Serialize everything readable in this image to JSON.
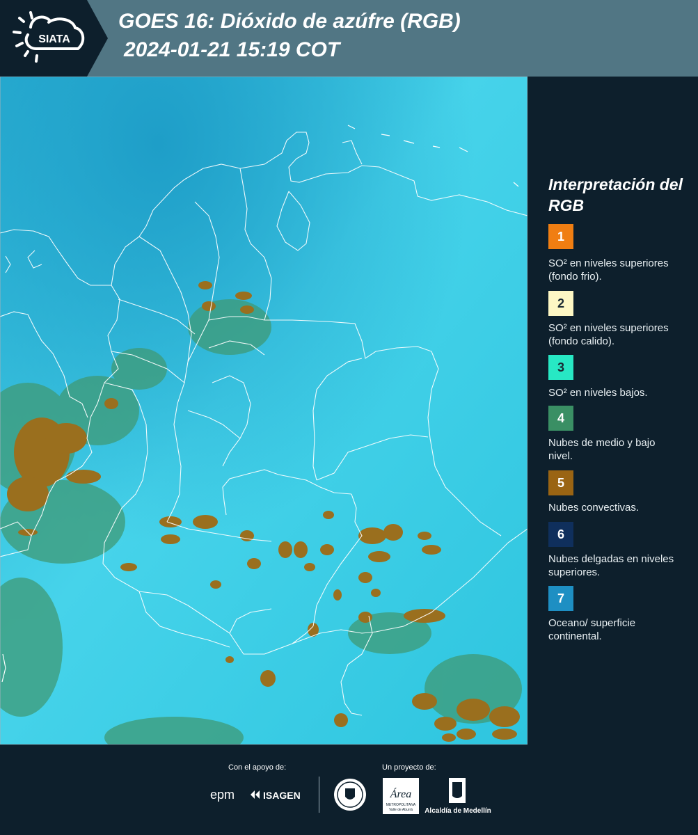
{
  "header": {
    "logo_text": "SIATA",
    "title_line1": "GOES 16: Dióxido de azúfre (RGB)",
    "title_line2": "2024-01-21 15:19 COT"
  },
  "legend": {
    "title": "Interpretación del RGB",
    "items": [
      {
        "number": "1",
        "color": "#f07e12",
        "text": "SO² en niveles superiores (fondo frio)."
      },
      {
        "number": "2",
        "color": "#fdf7c4",
        "text": "SO² en niveles superiores (fondo calido)."
      },
      {
        "number": "3",
        "color": "#27e8c4",
        "text": "SO² en niveles bajos."
      },
      {
        "number": "4",
        "color": "#3a8f64",
        "text": "Nubes de medio y bajo nivel."
      },
      {
        "number": "5",
        "color": "#9a6413",
        "text": "Nubes convectivas."
      },
      {
        "number": "6",
        "color": "#0f2f5c",
        "text": "Nubes delgadas en niveles superiores."
      },
      {
        "number": "7",
        "color": "#1e8fc3",
        "text": "Oceano/ superficie continental."
      }
    ]
  },
  "footer": {
    "support_label": "Con el apoyo de:",
    "project_label": "Un proyecto de:",
    "sponsors": {
      "epm": "epm",
      "isagen": "ISAGEN",
      "area_metro": "Área",
      "area_metro_sub": "METROPOLITANA",
      "area_metro_sub2": "Valle de Aburrá",
      "alcaldia": "Alcaldía de Medellín"
    }
  }
}
